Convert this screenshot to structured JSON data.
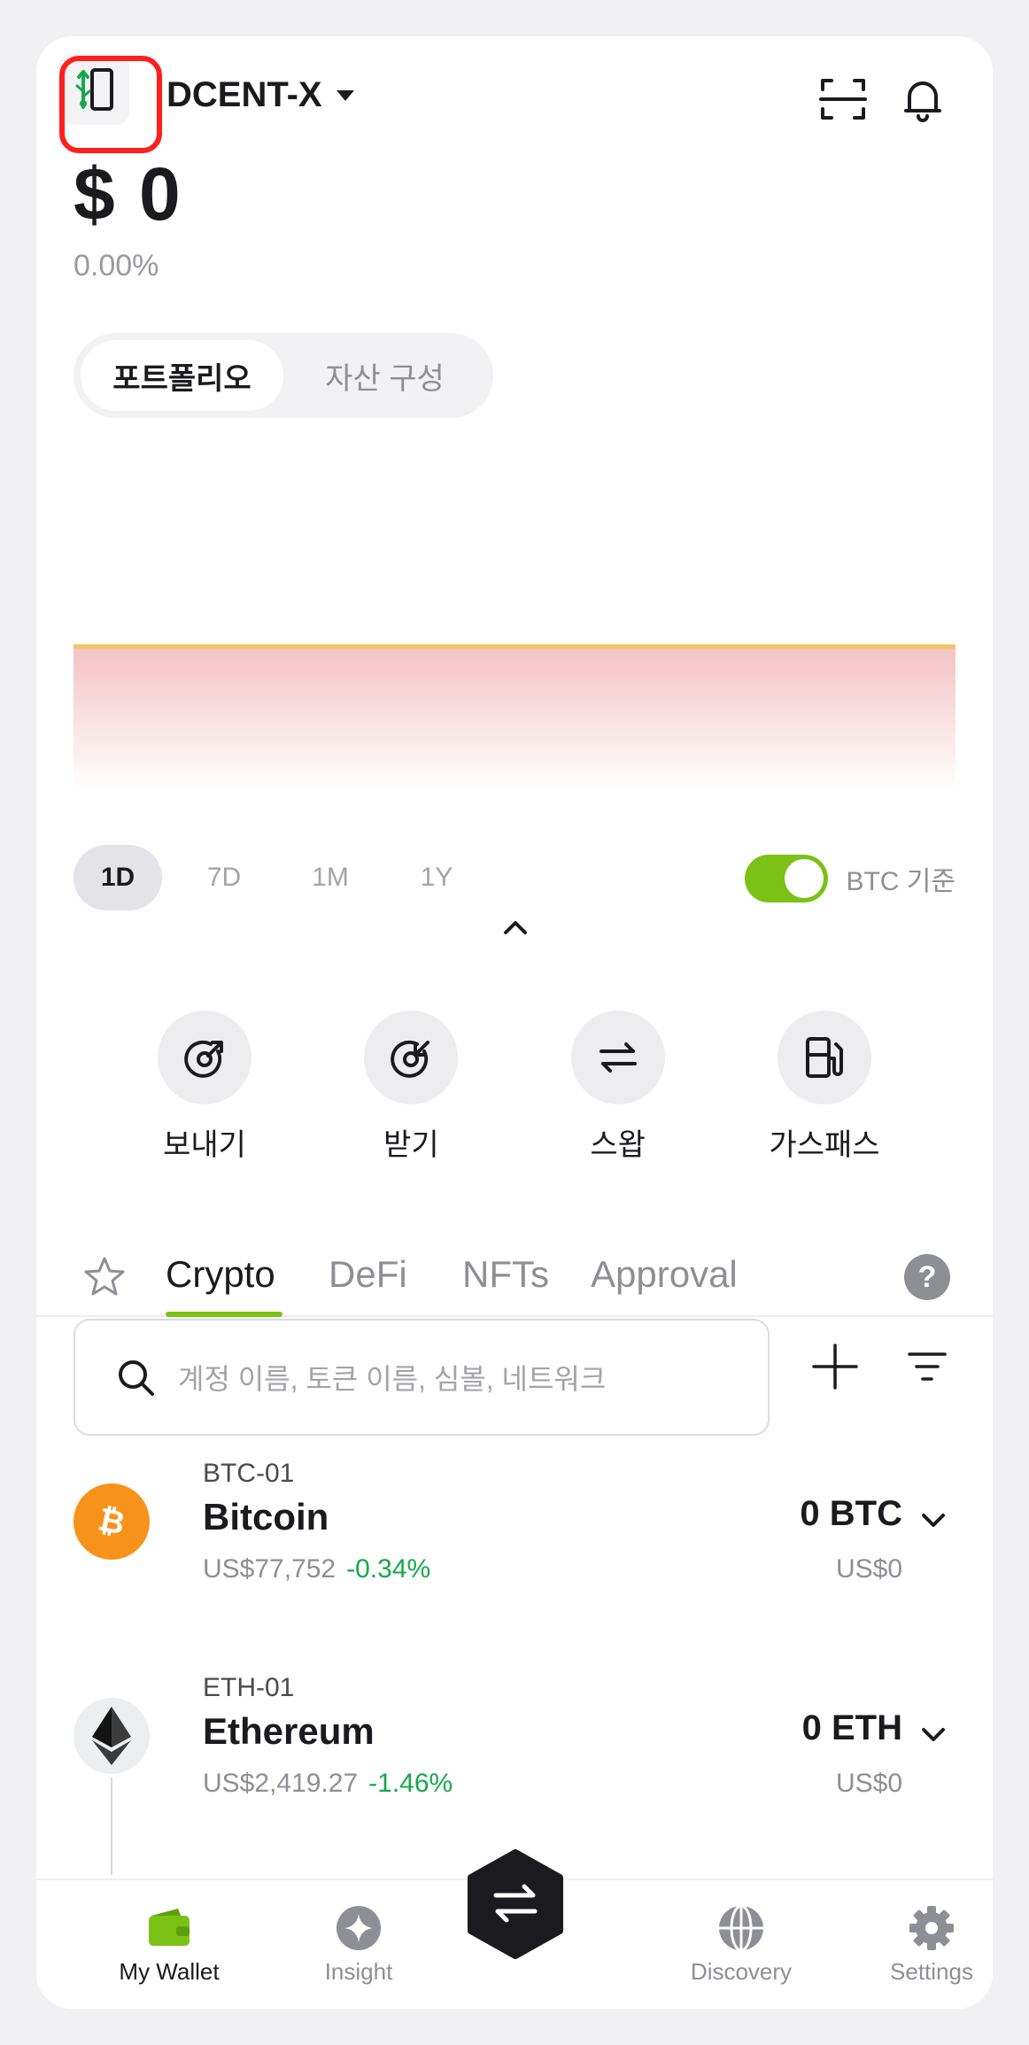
{
  "header": {
    "wallet_name": "DCENT-X",
    "balance": "$ 0",
    "change": "0.00%"
  },
  "segment": {
    "items": [
      "포트폴리오",
      "자산 구성"
    ],
    "active": 0
  },
  "periods": [
    "1D",
    "7D",
    "1M",
    "1Y"
  ],
  "active_period": "1D",
  "toggle": {
    "label": "BTC 기준",
    "on": true
  },
  "actions": [
    {
      "label": "보내기",
      "icon": "send-icon"
    },
    {
      "label": "받기",
      "icon": "receive-icon"
    },
    {
      "label": "스왑",
      "icon": "swap-icon"
    },
    {
      "label": "가스패스",
      "icon": "gas-pump-icon"
    }
  ],
  "tabs": [
    "Crypto",
    "DeFi",
    "NFTs",
    "Approval"
  ],
  "active_tab": "Crypto",
  "search": {
    "placeholder": "계정 이름, 토큰 이름, 심볼, 네트워크"
  },
  "assets": [
    {
      "account": "BTC-01",
      "name": "Bitcoin",
      "price": "US$77,752",
      "change": "-0.34%",
      "amount": "0 BTC",
      "usd": "US$0"
    },
    {
      "account": "ETH-01",
      "name": "Ethereum",
      "price": "US$2,419.27",
      "change": "-1.46%",
      "amount": "0 ETH",
      "usd": "US$0"
    }
  ],
  "nav": [
    {
      "label": "My Wallet",
      "icon": "wallet-icon",
      "active": true
    },
    {
      "label": "Insight",
      "icon": "sparkle-icon",
      "active": false
    },
    {
      "label": "Discovery",
      "icon": "globe-icon",
      "active": false
    },
    {
      "label": "Settings",
      "icon": "gear-icon",
      "active": false
    }
  ],
  "colors": {
    "accent": "#7cc116",
    "highlight": "#ff1f1f",
    "positive_pct": "#17a84b",
    "bitcoin": "#f7931a"
  }
}
